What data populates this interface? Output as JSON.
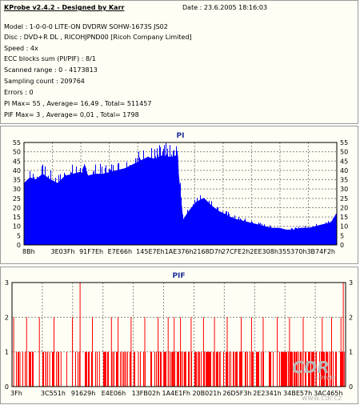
{
  "app": {
    "title": "KProbe v2.4.2 - Designed by Karr",
    "date": "Date : 23.6.2005 18:16:03"
  },
  "info": [
    "Model : 1-0-0-0 LITE-ON DVDRW SOHW-1673S JS02",
    "Disc : DVD+R DL , RICOHJPND00 [Ricoh Company Limited]",
    "Speed : 4x",
    "ECC blocks sum (PI/PIF) : 8/1",
    "Scanned range : 0 - 4173813",
    "Sampling count : 209764",
    "Errors : 0",
    "PI Max= 55 , Average= 16,49 , Total= 511457",
    "PIF Max= 3 , Average= 0,01 , Total= 1798"
  ],
  "watermark": {
    "big": "CDR",
    "small": "server",
    "url": "www.cdr.cz"
  },
  "colors": {
    "pi": "#0000ff",
    "pif": "#ff0000",
    "grid": "#8a8a8a",
    "title": "#1a2f9a",
    "panel": "#fffef4"
  },
  "chart_data": [
    {
      "type": "area",
      "title": "PI",
      "ylim": [
        0,
        55
      ],
      "y_ticks": [
        0,
        5,
        10,
        15,
        20,
        25,
        30,
        35,
        40,
        45,
        50,
        55
      ],
      "x_tick_labels": [
        "8Bh",
        "3E03Fh",
        "91F7Eh",
        "E7E66h",
        "145E7Eh",
        "1AE376h",
        "2168D7h",
        "27CFE2h",
        "2EE308h",
        "355370h",
        "3B74F2h"
      ],
      "x_range": [
        0,
        4173813
      ],
      "grid": true,
      "series": [
        {
          "color": "#0000ff",
          "x": [
            0,
            80000,
            160000,
            250000,
            350000,
            450000,
            550000,
            650000,
            750000,
            850000,
            950000,
            1050000,
            1150000,
            1250000,
            1350000,
            1450000,
            1550000,
            1650000,
            1750000,
            1850000,
            1950000,
            2050000,
            2060000,
            2120000,
            2200000,
            2300000,
            2400000,
            2500000,
            2600000,
            2700000,
            2800000,
            2900000,
            3000000,
            3100000,
            3200000,
            3300000,
            3400000,
            3500000,
            3600000,
            3700000,
            3800000,
            3900000,
            4000000,
            4100000,
            4173813
          ],
          "values": [
            33,
            36,
            35,
            38,
            35,
            33,
            37,
            38,
            39,
            37,
            38,
            38,
            39,
            40,
            41,
            43,
            45,
            47,
            46,
            48,
            47,
            48,
            38,
            13,
            18,
            23,
            25,
            21,
            18,
            16,
            14,
            13,
            12,
            11,
            10,
            9,
            9,
            8,
            8,
            9,
            9,
            10,
            11,
            12,
            17
          ]
        }
      ]
    },
    {
      "type": "bar",
      "title": "PIF",
      "ylim": [
        0,
        3
      ],
      "y_ticks": [
        0,
        1,
        2,
        3
      ],
      "x_tick_labels": [
        "3Fh",
        "3C551h",
        "91629h",
        "E4E06h",
        "13FB02h",
        "1A4E1Fh",
        "20B021h",
        "26D5F3h",
        "2E2341h",
        "34BE57h",
        "3AC465h"
      ],
      "x_range": [
        0,
        4173813
      ],
      "grid": true,
      "series": [
        {
          "color": "#ff0000",
          "positions": [
            0.005,
            0.024,
            0.044,
            0.063,
            0.082,
            0.101,
            0.113,
            0.126,
            0.147,
            0.164,
            0.181,
            0.198,
            0.204,
            0.222,
            0.241,
            0.262,
            0.279,
            0.298,
            0.302,
            0.318,
            0.338,
            0.357,
            0.379,
            0.398,
            0.418,
            0.438,
            0.455,
            0.468,
            0.478,
            0.482,
            0.486,
            0.495,
            0.505,
            0.521,
            0.537,
            0.559,
            0.574,
            0.594,
            0.607,
            0.624,
            0.645,
            0.664,
            0.687,
            0.706,
            0.718,
            0.735,
            0.753,
            0.772,
            0.795,
            0.813,
            0.832,
            0.851,
            0.873,
            0.892,
            0.911,
            0.93,
            0.944,
            0.958,
            0.97,
            0.986,
            0.993,
            0.996
          ],
          "values": [
            2,
            1,
            2,
            1,
            2,
            1,
            1,
            2,
            1,
            1,
            2,
            1,
            3,
            1,
            2,
            1,
            1,
            2,
            1,
            2,
            1,
            2,
            1,
            2,
            1,
            2,
            1,
            2,
            1,
            1,
            2,
            1,
            2,
            1,
            2,
            1,
            2,
            1,
            2,
            1,
            2,
            1,
            2,
            1,
            2,
            1,
            2,
            1,
            2,
            1,
            2,
            1,
            2,
            1,
            1,
            2,
            1,
            2,
            1,
            2,
            3,
            1
          ]
        }
      ]
    }
  ]
}
